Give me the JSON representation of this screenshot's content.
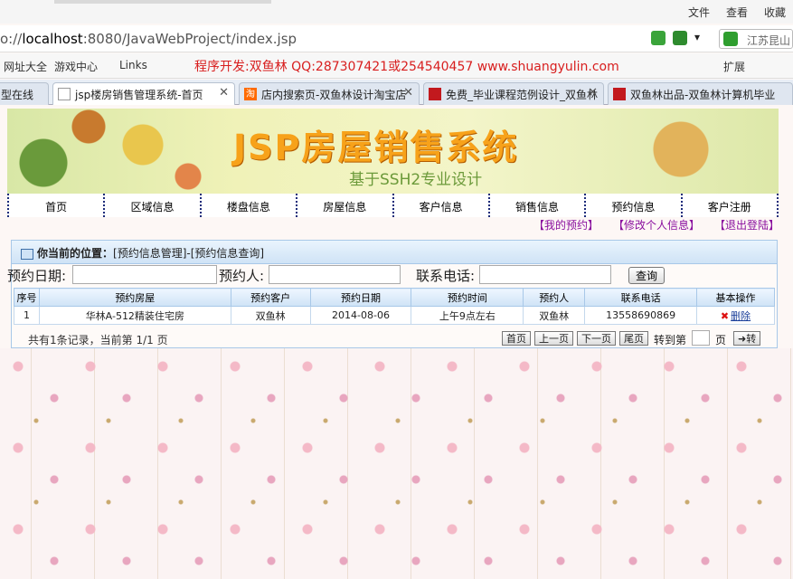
{
  "browser": {
    "menu": [
      "文件",
      "查看",
      "收藏"
    ],
    "url_host": "localhost",
    "url_prefix": "o://",
    "url_rest": ":8080/JavaWebProject/index.jsp",
    "search_placeholder": "江苏昆山",
    "favorites": [
      "网址大全",
      "游戏中心",
      "Links"
    ],
    "promo": "程序开发:双鱼林 QQ:287307421或254540457 www.shuangyulin.com",
    "extension_label": "扩展",
    "tabs": [
      {
        "label": "型在线"
      },
      {
        "label": "jsp楼房销售管理系统-首页"
      },
      {
        "label": "店内搜索页-双鱼林设计淘宝店"
      },
      {
        "label": "免费_毕业课程范例设计_双鱼林"
      },
      {
        "label": "双鱼林出品-双鱼林计算机毕业"
      }
    ]
  },
  "banner": {
    "title": "JSP房屋销售系统",
    "subtitle": "基于SSH2专业设计"
  },
  "nav": [
    "首页",
    "区域信息",
    "楼盘信息",
    "房屋信息",
    "客户信息",
    "销售信息",
    "预约信息",
    "客户注册"
  ],
  "user_links": [
    "【我的预约】",
    "【修改个人信息】",
    "【退出登陆】"
  ],
  "location": {
    "label": "你当前的位置：",
    "path": "[预约信息管理]-[预约信息查询]"
  },
  "search": {
    "date_label": "预约日期:",
    "person_label": "预约人:",
    "phone_label": "联系电话:",
    "button": "查询"
  },
  "table": {
    "headers": [
      "序号",
      "预约房屋",
      "预约客户",
      "预约日期",
      "预约时间",
      "预约人",
      "联系电话",
      "基本操作"
    ],
    "rows": [
      [
        "1",
        "华林A-512精装住宅房",
        "双鱼林",
        "2014-08-06",
        "上午9点左右",
        "双鱼林",
        "13558690869",
        "删除"
      ]
    ]
  },
  "pager": {
    "info": "共有1条记录，当前第 1/1 页",
    "first": "首页",
    "prev": "上一页",
    "next": "下一页",
    "last": "尾页",
    "goto_label": "转到第",
    "page_label": "页",
    "go": "➜转"
  }
}
